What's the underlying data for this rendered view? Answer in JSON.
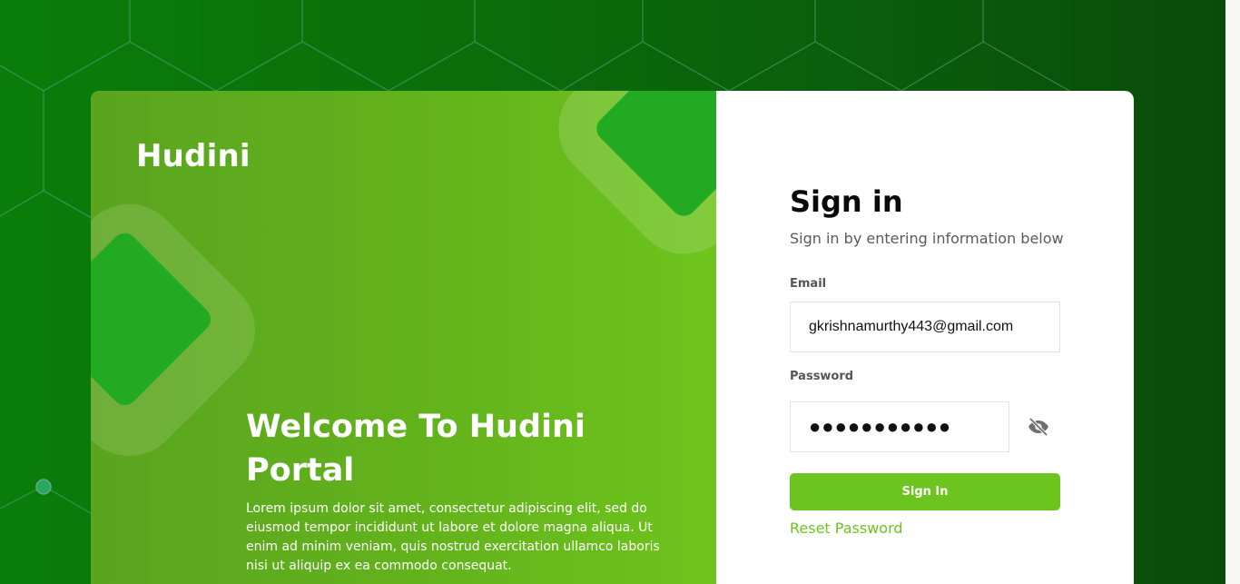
{
  "brand": {
    "name": "Hudini"
  },
  "welcome": {
    "title": "Welcome To Hudini Portal",
    "text": "Lorem ipsum dolor sit amet, consectetur adipiscing elit, sed do eiusmod tempor incididunt ut labore et dolore magna aliqua. Ut enim ad minim veniam, quis nostrud exercitation ullamco laboris nisi ut aliquip ex ea commodo consequat."
  },
  "signin": {
    "title": "Sign in",
    "subtitle": "Sign in by entering information below",
    "email_label": "Email",
    "email_value": "gkrishnamurthy443@gmail.com",
    "password_label": "Password",
    "password_value": "●●●●●●●●●●●",
    "password_toggle_icon": "eye-slash-icon",
    "button_label": "Sign In",
    "reset_label": "Reset Password"
  },
  "colors": {
    "accent": "#6cc51e",
    "panel_green": "#63b31c",
    "diamond_green": "#22ab22",
    "background_green": "#0a6d0a"
  }
}
